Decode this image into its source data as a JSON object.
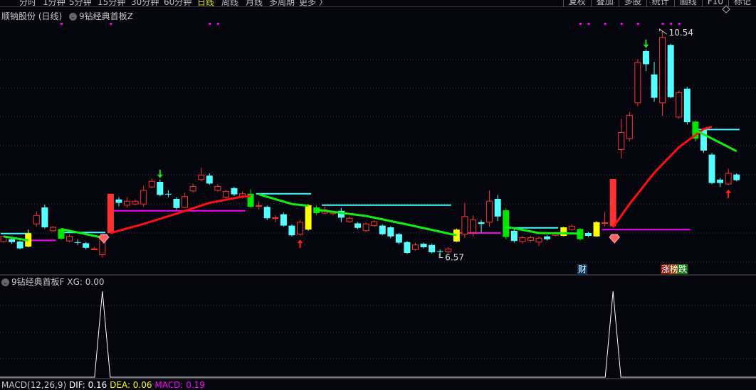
{
  "toolbar": {
    "left": [
      "分时",
      "1分钟",
      "5分钟",
      "15分钟",
      "30分钟",
      "60分钟",
      "日线",
      "周线",
      "月线",
      "多周期",
      "更多 〉"
    ],
    "active_index": 6,
    "right": [
      "复权",
      "叠加",
      "多股",
      "统计",
      "画线",
      "F10",
      "标记"
    ]
  },
  "main": {
    "stock": "顺钠股份 (日线)",
    "indicator": "9钻经典首板Z",
    "high_label": "10.54",
    "low_label": "6.57",
    "tags": {
      "cai": "财",
      "zhang": "涨",
      "bang": "榜",
      "die": "跌"
    }
  },
  "sub": {
    "title": "9钻经典首板F",
    "xg_label": "XG:",
    "xg_value": "0.00"
  },
  "macd": {
    "name": "MACD(12,26,9)",
    "dif": "DIF: 0.16",
    "dea": "DEA: 0.06",
    "macd": "MACD: 0.19"
  },
  "colors": {
    "up": "#ff3232",
    "down": "#54ffff",
    "yellow": "#ffff00",
    "green": "#00e600",
    "magenta": "#ff00ff",
    "grid": "#404040",
    "dots": "#ff00ff"
  },
  "chart_data": {
    "type": "candlestick",
    "ylim": [
      6.57,
      10.54
    ],
    "candles": [
      [
        6.84,
        6.93,
        6.95,
        6.82,
        "up"
      ],
      [
        6.88,
        6.83,
        6.9,
        6.8,
        "down"
      ],
      [
        6.84,
        6.72,
        6.86,
        6.7,
        "down"
      ],
      [
        6.75,
        6.98,
        7.05,
        6.74,
        "yellow"
      ],
      [
        7.15,
        7.3,
        7.37,
        7.1,
        "up"
      ],
      [
        7.44,
        7.09,
        7.49,
        7.07,
        "down"
      ],
      [
        7.03,
        7.09,
        7.11,
        7.01,
        "up"
      ],
      [
        7.06,
        6.89,
        7.08,
        6.87,
        "green"
      ],
      [
        6.85,
        6.93,
        6.97,
        6.83,
        "up"
      ],
      [
        6.83,
        6.82,
        6.88,
        6.78,
        "down"
      ],
      [
        6.81,
        6.73,
        6.83,
        6.7,
        "down"
      ],
      [
        6.7,
        6.71,
        6.75,
        6.7,
        "up"
      ],
      [
        6.61,
        6.93,
        6.97,
        6.56,
        "up"
      ],
      [
        6.99,
        7.68,
        7.68,
        6.98,
        "limit"
      ],
      [
        7.58,
        7.52,
        7.62,
        7.46,
        "down"
      ],
      [
        7.48,
        7.55,
        7.62,
        7.44,
        "up"
      ],
      [
        7.5,
        7.55,
        7.58,
        7.48,
        "up"
      ],
      [
        7.5,
        7.74,
        7.82,
        7.45,
        "up"
      ],
      [
        7.8,
        7.9,
        7.95,
        7.78,
        "up"
      ],
      [
        7.89,
        7.66,
        7.93,
        7.64,
        "down"
      ],
      [
        7.68,
        7.67,
        7.74,
        7.62,
        "down"
      ],
      [
        7.59,
        7.43,
        7.62,
        7.4,
        "down"
      ],
      [
        7.44,
        7.63,
        7.7,
        7.43,
        "up"
      ],
      [
        7.73,
        7.81,
        7.86,
        7.7,
        "up"
      ],
      [
        7.93,
        8.01,
        8.14,
        7.9,
        "up"
      ],
      [
        8.0,
        7.86,
        8.04,
        7.84,
        "down"
      ],
      [
        7.74,
        7.81,
        7.85,
        7.72,
        "up"
      ],
      [
        7.62,
        7.72,
        7.75,
        7.57,
        "up"
      ],
      [
        7.78,
        7.67,
        7.8,
        7.64,
        "down"
      ],
      [
        7.62,
        7.68,
        7.72,
        7.6,
        "up"
      ],
      [
        7.68,
        7.45,
        7.76,
        7.43,
        "green"
      ],
      [
        7.46,
        7.47,
        7.55,
        7.4,
        "up"
      ],
      [
        7.45,
        7.25,
        7.47,
        7.22,
        "down"
      ],
      [
        7.25,
        7.26,
        7.3,
        7.18,
        "up"
      ],
      [
        7.32,
        7.12,
        7.35,
        7.1,
        "down"
      ],
      [
        7.12,
        6.95,
        7.14,
        6.93,
        "down"
      ],
      [
        6.97,
        7.18,
        7.22,
        6.95,
        "up"
      ],
      [
        7.05,
        7.48,
        7.5,
        7.03,
        "yellow"
      ],
      [
        7.44,
        7.34,
        7.47,
        7.31,
        "green"
      ],
      [
        7.34,
        7.4,
        7.48,
        7.32,
        "up"
      ],
      [
        7.33,
        7.35,
        7.38,
        7.3,
        "up"
      ],
      [
        7.38,
        7.26,
        7.43,
        7.18,
        "down"
      ],
      [
        7.19,
        7.25,
        7.28,
        7.17,
        "up"
      ],
      [
        7.16,
        7.08,
        7.18,
        7.06,
        "down"
      ],
      [
        7.03,
        7.15,
        7.18,
        7.01,
        "up"
      ],
      [
        7.12,
        7.19,
        7.22,
        7.1,
        "up"
      ],
      [
        7.12,
        6.97,
        7.14,
        6.95,
        "down"
      ],
      [
        7.09,
        6.93,
        7.11,
        6.9,
        "down"
      ],
      [
        6.97,
        6.82,
        6.99,
        6.79,
        "down"
      ],
      [
        6.83,
        6.64,
        6.85,
        6.62,
        "down"
      ],
      [
        6.7,
        6.78,
        6.82,
        6.68,
        "up"
      ],
      [
        6.8,
        6.74,
        6.82,
        6.72,
        "down"
      ],
      [
        6.78,
        6.65,
        6.8,
        6.63,
        "down"
      ],
      [
        6.67,
        6.66,
        6.7,
        6.57,
        "down"
      ],
      [
        6.66,
        6.71,
        6.74,
        6.64,
        "up"
      ],
      [
        6.84,
        7.05,
        7.07,
        6.83,
        "yellow"
      ],
      [
        6.97,
        7.28,
        7.52,
        6.9,
        "up"
      ],
      [
        7.0,
        7.22,
        7.3,
        6.93,
        "up"
      ],
      [
        7.18,
        7.15,
        7.22,
        7.0,
        "down"
      ],
      [
        7.18,
        7.55,
        7.74,
        7.1,
        "up"
      ],
      [
        7.59,
        7.28,
        7.66,
        7.2,
        "down"
      ],
      [
        7.39,
        6.92,
        7.42,
        6.88,
        "green"
      ],
      [
        7.03,
        6.85,
        7.06,
        6.82,
        "down"
      ],
      [
        6.84,
        6.91,
        6.94,
        6.8,
        "up"
      ],
      [
        6.86,
        6.91,
        6.94,
        6.84,
        "up"
      ],
      [
        6.83,
        6.9,
        6.93,
        6.76,
        "up"
      ],
      [
        6.93,
        6.88,
        6.95,
        6.86,
        "down"
      ],
      [
        6.95,
        6.99,
        7.01,
        6.93,
        "up"
      ],
      [
        6.94,
        7.09,
        7.1,
        6.93,
        "yellow"
      ],
      [
        7.05,
        7.11,
        7.14,
        7.03,
        "up"
      ],
      [
        7.06,
        6.88,
        7.08,
        6.86,
        "green"
      ],
      [
        6.99,
        6.94,
        7.01,
        6.92,
        "down"
      ],
      [
        6.93,
        7.18,
        7.2,
        6.92,
        "yellow"
      ],
      [
        7.16,
        7.17,
        7.36,
        7.1,
        "up"
      ],
      [
        7.11,
        7.94,
        7.94,
        7.1,
        "limit"
      ],
      [
        8.46,
        8.76,
        9.0,
        8.3,
        "up"
      ],
      [
        8.65,
        9.06,
        9.12,
        8.6,
        "up"
      ],
      [
        9.28,
        9.99,
        10.05,
        9.22,
        "up"
      ],
      [
        10.19,
        9.96,
        10.22,
        9.84,
        "down"
      ],
      [
        9.78,
        9.37,
        10.0,
        9.3,
        "down"
      ],
      [
        9.28,
        10.43,
        10.54,
        9.05,
        "up"
      ],
      [
        10.3,
        9.38,
        10.32,
        9.36,
        "down"
      ],
      [
        9.03,
        9.46,
        9.5,
        9.0,
        "up"
      ],
      [
        9.53,
        8.94,
        9.56,
        8.9,
        "down"
      ],
      [
        8.95,
        8.65,
        8.97,
        8.6,
        "green"
      ],
      [
        8.8,
        8.44,
        8.83,
        8.4,
        "down"
      ],
      [
        8.37,
        7.87,
        8.4,
        7.85,
        "down"
      ],
      [
        7.93,
        7.87,
        7.96,
        7.8,
        "down"
      ],
      [
        7.85,
        8.04,
        8.12,
        7.83,
        "up"
      ],
      [
        8.02,
        7.92,
        8.04,
        7.9,
        "down"
      ]
    ],
    "red_lines": [
      [
        [
          13,
          6.99
        ],
        [
          17,
          7.15
        ],
        [
          21,
          7.33
        ],
        [
          25,
          7.52
        ],
        [
          29,
          7.63
        ],
        [
          30,
          7.64
        ]
      ],
      [
        [
          74,
          7.09
        ],
        [
          76,
          7.5
        ],
        [
          79,
          8.05
        ],
        [
          82,
          8.5
        ],
        [
          85,
          8.82
        ],
        [
          86,
          8.86
        ]
      ]
    ],
    "green_lines": [
      [
        [
          0,
          6.93
        ],
        [
          3,
          6.86
        ]
      ],
      [
        [
          7,
          7.06
        ],
        [
          12,
          6.91
        ]
      ],
      [
        [
          31,
          7.67
        ],
        [
          35,
          7.5
        ],
        [
          37,
          7.47
        ]
      ],
      [
        [
          38,
          7.4
        ],
        [
          44,
          7.29
        ],
        [
          49,
          7.14
        ],
        [
          55,
          6.95
        ]
      ],
      [
        [
          61,
          7.1
        ],
        [
          65,
          6.99
        ],
        [
          70,
          6.98
        ]
      ],
      [
        [
          84,
          8.8
        ],
        [
          89,
          8.43
        ]
      ]
    ],
    "cyan_levels": [
      [
        0,
        3,
        6.98
      ],
      [
        7,
        12,
        7.0
      ],
      [
        31,
        37,
        7.68
      ],
      [
        39,
        54,
        7.48
      ],
      [
        61,
        67,
        7.08
      ],
      [
        84,
        89,
        8.81
      ]
    ],
    "magenta_levels": [
      [
        3,
        6,
        6.86
      ],
      [
        13,
        29,
        7.38
      ],
      [
        55,
        60,
        6.99
      ],
      [
        73,
        83,
        7.05
      ]
    ],
    "signal_dots": [
      7,
      13,
      25,
      26,
      70,
      71,
      73,
      75,
      77,
      80,
      81,
      82
    ],
    "sell_arrows": [
      19,
      78
    ],
    "buy_arrows": [
      36,
      88
    ],
    "diamonds": [
      12,
      74
    ],
    "xg_spikes": [
      12,
      74
    ]
  }
}
